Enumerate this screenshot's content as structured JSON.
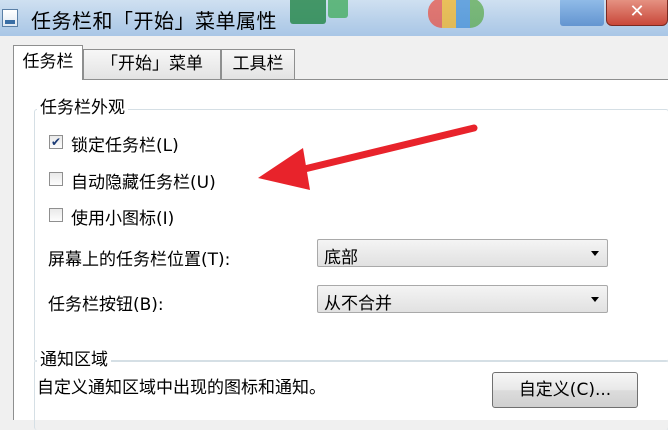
{
  "window": {
    "title": "任务栏和「开始」菜单属性",
    "close_label": "✕"
  },
  "tabs": [
    {
      "label": "任务栏",
      "active": true
    },
    {
      "label": "「开始」菜单",
      "active": false
    },
    {
      "label": "工具栏",
      "active": false
    }
  ],
  "appearance": {
    "legend": "任务栏外观",
    "checkboxes": [
      {
        "label": "锁定任务栏(L)",
        "checked": true
      },
      {
        "label": "自动隐藏任务栏(U)",
        "checked": false
      },
      {
        "label": "使用小图标(I)",
        "checked": false
      }
    ],
    "position": {
      "label": "屏幕上的任务栏位置(T):",
      "value": "底部"
    },
    "buttons": {
      "label": "任务栏按钮(B):",
      "value": "从不合并"
    }
  },
  "notification": {
    "legend": "通知区域",
    "description": "自定义通知区域中出现的图标和通知。",
    "customize_label": "自定义(C)..."
  },
  "colors": {
    "annotation_arrow": "#e8232b",
    "checkmark": "#1c3b75"
  },
  "icons": {
    "checkmark": "✔",
    "dropdown": "chevron-down-icon"
  }
}
